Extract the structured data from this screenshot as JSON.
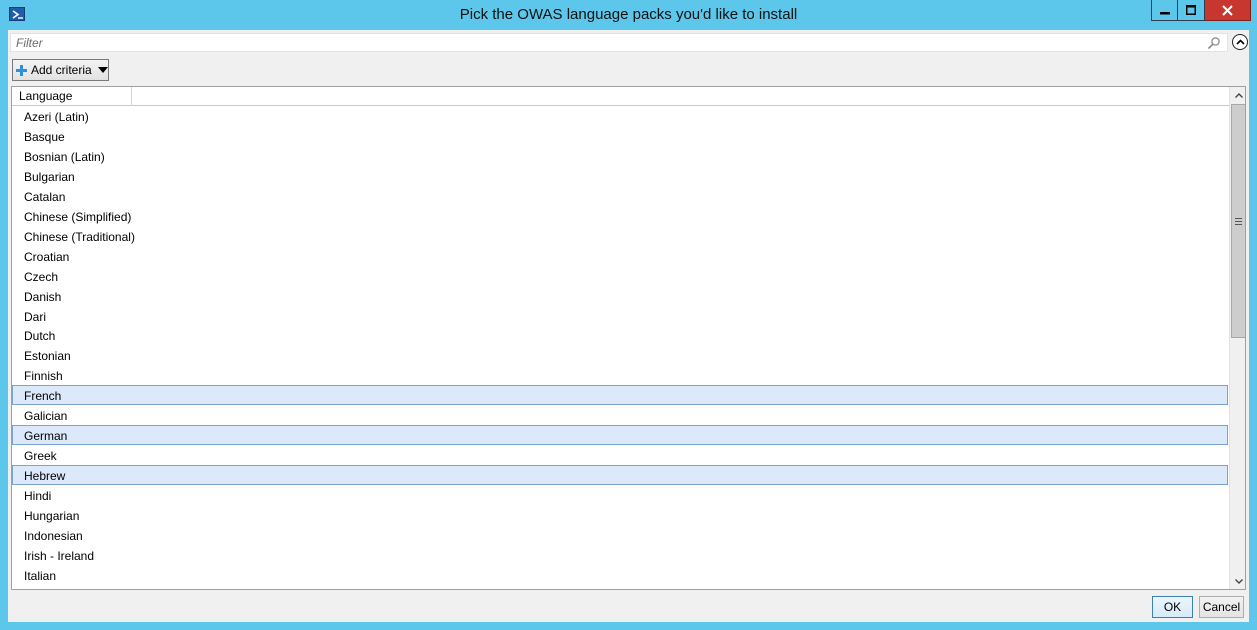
{
  "window": {
    "title": "Pick the OWAS language packs you'd like to install",
    "icon": "powershell-icon",
    "controls": {
      "minimize": "minimize-icon",
      "maximize": "maximize-icon",
      "close": "close-icon"
    }
  },
  "filter": {
    "placeholder": "Filter",
    "value": "",
    "search_icon": "search-icon",
    "collapse_icon": "chevron-up-circle-icon"
  },
  "criteria": {
    "label": "Add criteria",
    "icon": "plus-icon"
  },
  "list": {
    "columns": [
      "Language"
    ],
    "rows": [
      {
        "label": "Azeri (Latin)",
        "selected": false
      },
      {
        "label": "Basque",
        "selected": false
      },
      {
        "label": "Bosnian (Latin)",
        "selected": false
      },
      {
        "label": "Bulgarian",
        "selected": false
      },
      {
        "label": "Catalan",
        "selected": false
      },
      {
        "label": "Chinese (Simplified)",
        "selected": false
      },
      {
        "label": "Chinese (Traditional)",
        "selected": false
      },
      {
        "label": "Croatian",
        "selected": false
      },
      {
        "label": "Czech",
        "selected": false
      },
      {
        "label": "Danish",
        "selected": false
      },
      {
        "label": "Dari",
        "selected": false
      },
      {
        "label": "Dutch",
        "selected": false
      },
      {
        "label": "Estonian",
        "selected": false
      },
      {
        "label": "Finnish",
        "selected": false
      },
      {
        "label": "French",
        "selected": true
      },
      {
        "label": "Galician",
        "selected": false
      },
      {
        "label": "German",
        "selected": true
      },
      {
        "label": "Greek",
        "selected": false
      },
      {
        "label": "Hebrew",
        "selected": true
      },
      {
        "label": "Hindi",
        "selected": false
      },
      {
        "label": "Hungarian",
        "selected": false
      },
      {
        "label": "Indonesian",
        "selected": false
      },
      {
        "label": "Irish - Ireland",
        "selected": false
      },
      {
        "label": "Italian",
        "selected": false
      }
    ]
  },
  "buttons": {
    "ok": "OK",
    "cancel": "Cancel"
  },
  "colors": {
    "titlebar": "#5cc7ea",
    "close": "#c7372f",
    "selected_row": "#dbe9fa",
    "selected_border": "#7da2ce"
  }
}
